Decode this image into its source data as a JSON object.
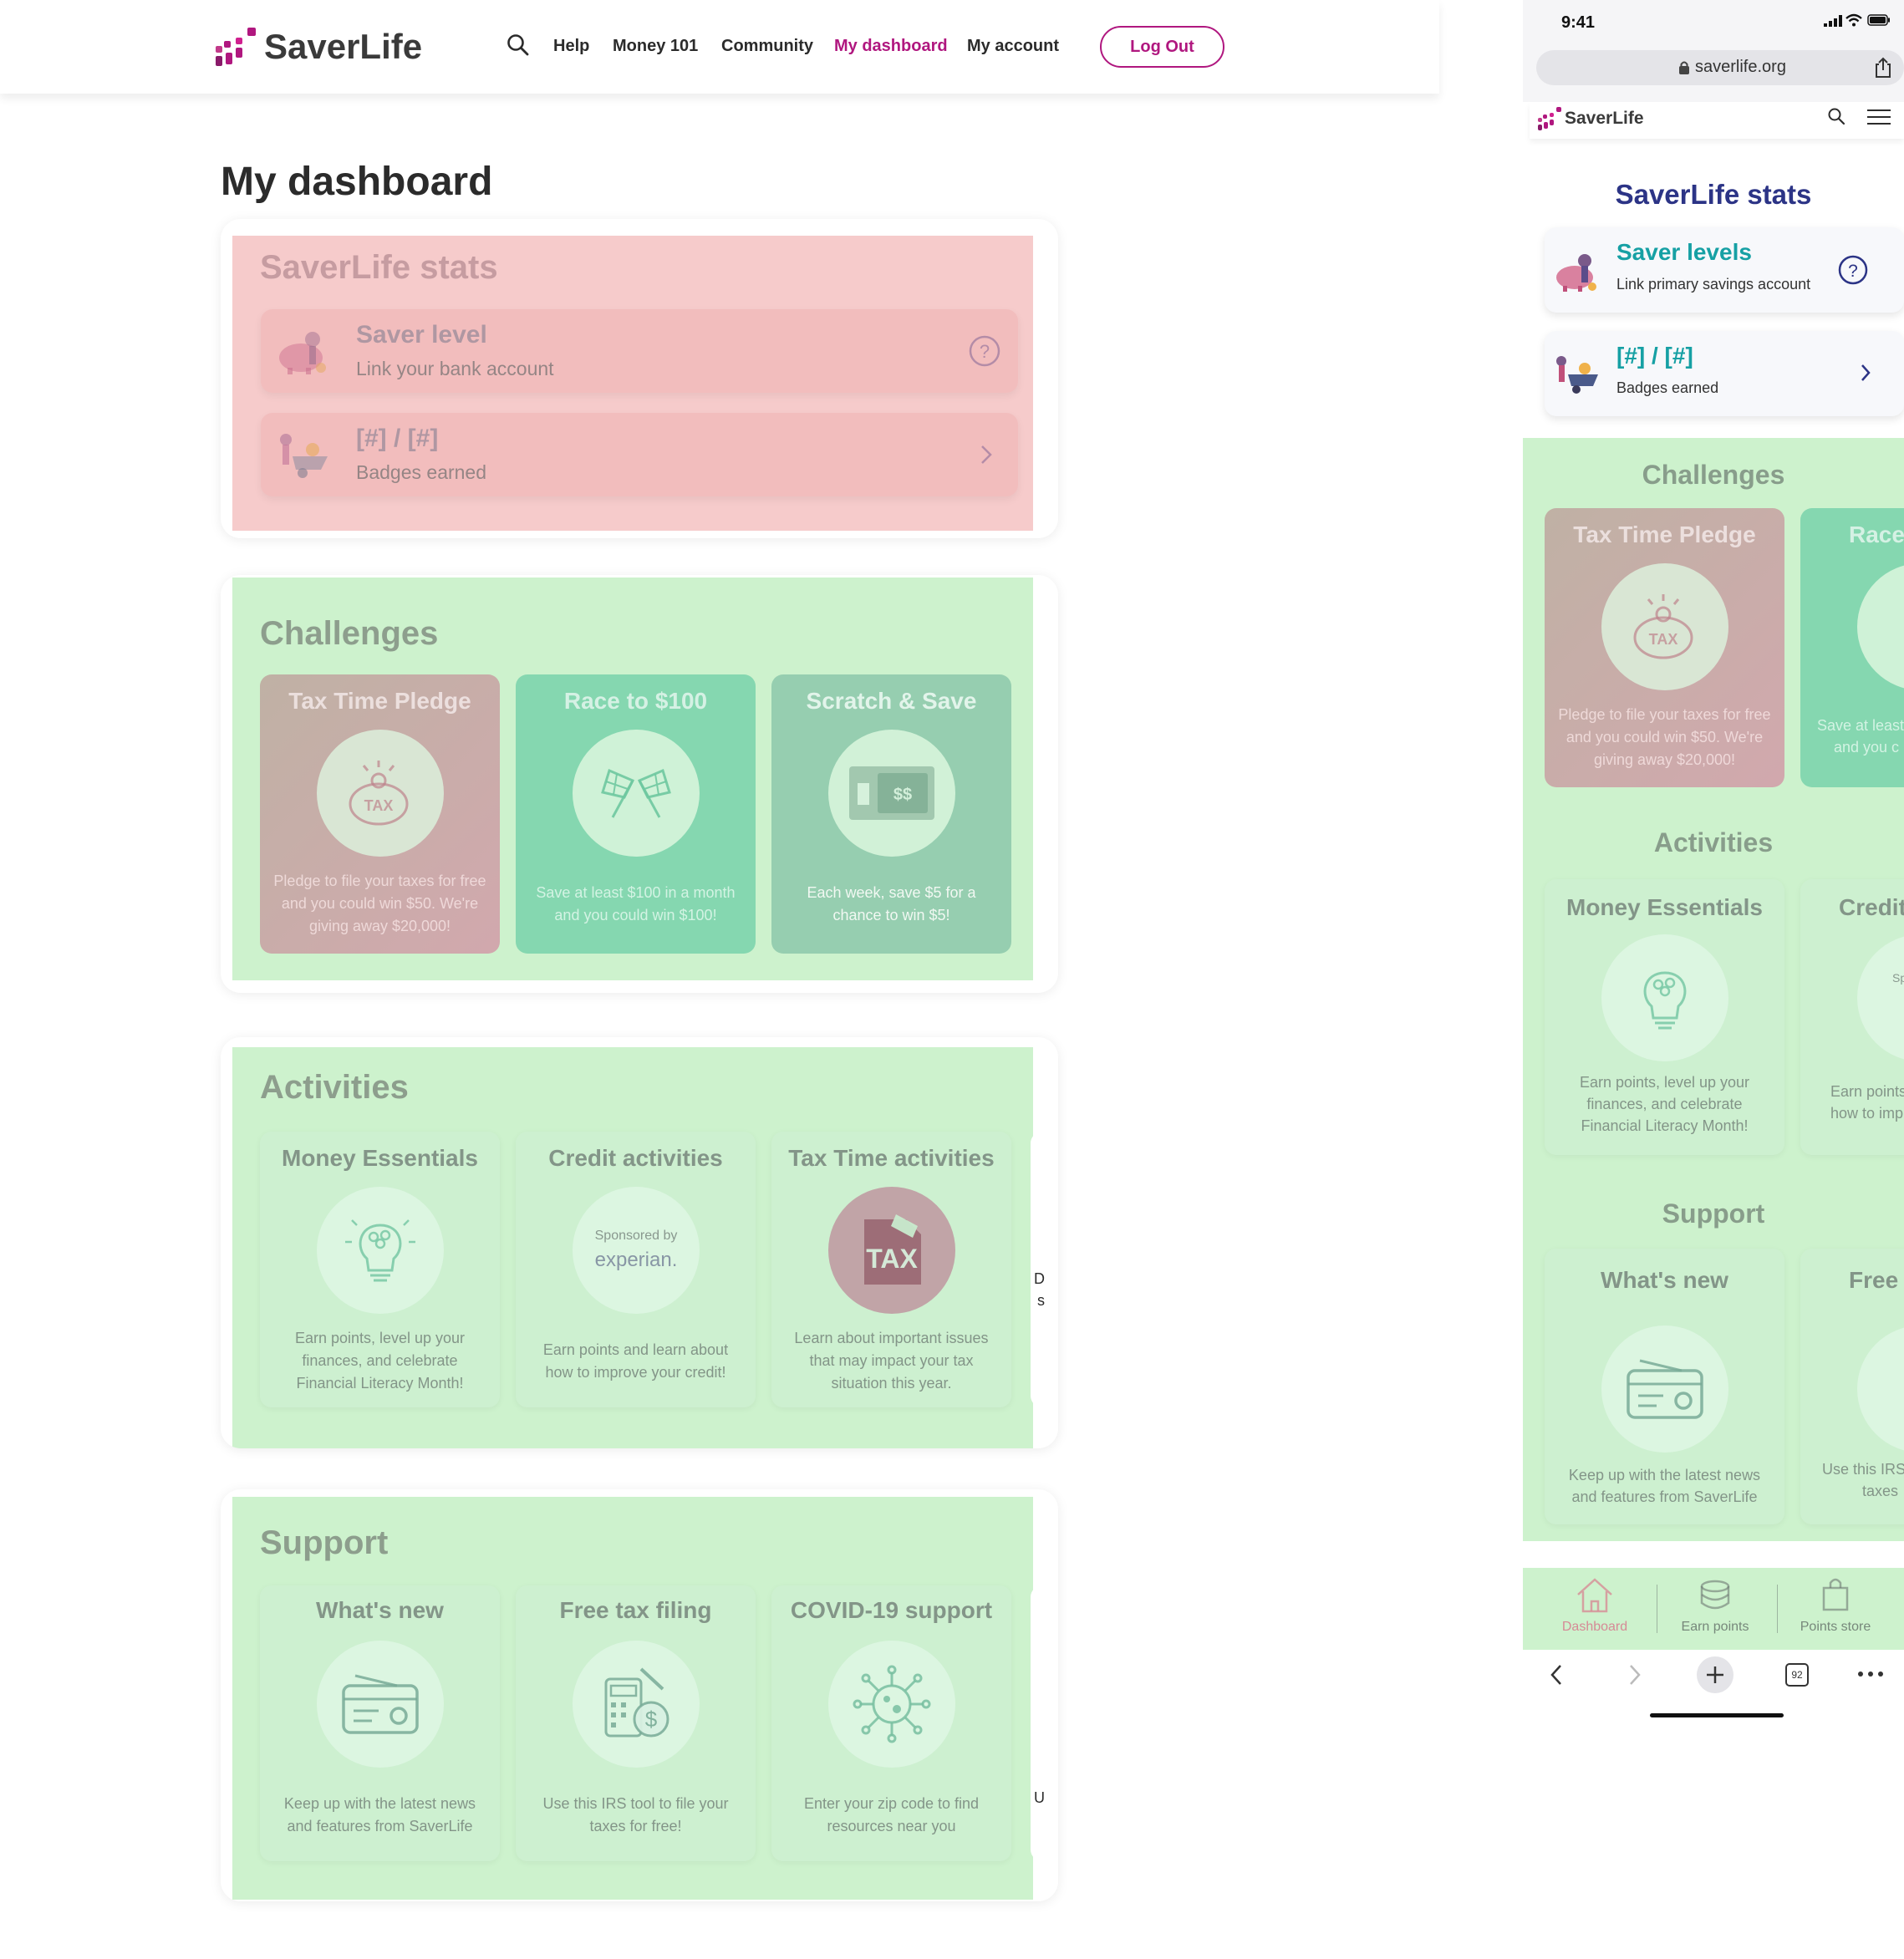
{
  "brand": {
    "name": "SaverLife",
    "colors": {
      "magenta": "#b0177f",
      "navy": "#2c3486",
      "teal": "#16a0a4",
      "overlay_red": "#efa5a5",
      "overlay_green": "#a4e8a4"
    }
  },
  "desktop": {
    "nav": {
      "search_icon": "search-icon",
      "items": [
        {
          "label": "Help",
          "active": false
        },
        {
          "label": "Money 101",
          "active": false
        },
        {
          "label": "Community",
          "active": false
        },
        {
          "label": "My dashboard",
          "active": true
        },
        {
          "label": "My account",
          "active": false
        }
      ],
      "logout_label": "Log Out"
    },
    "page_title": "My dashboard",
    "stats": {
      "title": "SaverLife stats",
      "level": {
        "title": "Saver level",
        "subtitle": "Link your bank account",
        "icon": "help-circle-icon"
      },
      "badges": {
        "title": "[#] / [#]",
        "subtitle": "Badges earned",
        "icon": "chevron-right-icon"
      }
    },
    "challenges": {
      "title": "Challenges",
      "cards": [
        {
          "title": "Tax Time Pledge",
          "icon": "tax-piggy-bank-icon",
          "desc": "Pledge to file your taxes for free and you could win $50. We're giving away $20,000!"
        },
        {
          "title": "Race to $100",
          "icon": "checkered-flags-icon",
          "desc": "Save at least $100 in a month and you could win $100!"
        },
        {
          "title": "Scratch & Save",
          "icon": "scratch-ticket-icon",
          "desc": "Each week, save $5 for a chance to win $5!"
        }
      ]
    },
    "activities": {
      "title": "Activities",
      "cards": [
        {
          "title": "Money Essentials",
          "icon": "lightbulb-coins-icon",
          "desc": "Earn points, level up your finances, and celebrate Financial Literacy Month!"
        },
        {
          "title": "Credit activities",
          "sponsor": "Sponsored by",
          "sponsor_name": "experian.",
          "icon": "experian-logo-icon",
          "desc": "Earn points and learn about how to improve your credit!"
        },
        {
          "title": "Tax Time activities",
          "icon": "tax-document-icon",
          "tax_label": "TAX",
          "desc": "Learn about important issues that may impact your tax situation this year."
        }
      ],
      "peek_text": [
        "D",
        "s"
      ]
    },
    "support": {
      "title": "Support",
      "cards": [
        {
          "title": "What's new",
          "icon": "radio-icon",
          "desc": "Keep up with the latest news and features from SaverLife"
        },
        {
          "title": "Free tax filing",
          "icon": "calculator-dollar-icon",
          "desc": "Use this IRS tool to file your taxes for free!"
        },
        {
          "title": "COVID-19 support",
          "icon": "virus-icon",
          "desc": "Enter your zip code to find resources near you"
        }
      ],
      "peek_text": "U"
    }
  },
  "mobile": {
    "status": {
      "time": "9:41"
    },
    "url": "saverlife.org",
    "stats": {
      "title": "SaverLife stats",
      "level": {
        "title": "Saver levels",
        "subtitle": "Link primary savings account"
      },
      "badges": {
        "title": "[#] / [#]",
        "subtitle": "Badges earned"
      }
    },
    "challenges": {
      "title": "Challenges",
      "card": {
        "title": "Tax Time Pledge",
        "desc": "Pledge to file your taxes for free and you could win $50. We're giving away $20,000!"
      },
      "peek": {
        "title": "Race",
        "desc_1": "Save at least",
        "desc_2": "and you c"
      }
    },
    "activities": {
      "title": "Activities",
      "card": {
        "title": "Money Essentials",
        "desc": "Earn points, level up your finances, and celebrate Financial Literacy Month!"
      },
      "peek": {
        "title": "Credit",
        "sponsor": "Spon",
        "desc_1": "Earn points",
        "desc_2": "how to imp"
      }
    },
    "support": {
      "title": "Support",
      "card": {
        "title": "What's new",
        "desc": "Keep up with the latest news and features from SaverLife"
      },
      "peek": {
        "title": "Free t",
        "desc_1": "Use this IRS",
        "desc_2": "taxes"
      }
    },
    "tabbar": [
      {
        "label": "Dashboard",
        "icon": "house-icon",
        "active": true
      },
      {
        "label": "Earn points",
        "icon": "coins-stack-icon",
        "active": false
      },
      {
        "label": "Points store",
        "icon": "shopping-bag-icon",
        "active": false
      }
    ],
    "browser": {
      "tab_count": "92"
    }
  }
}
